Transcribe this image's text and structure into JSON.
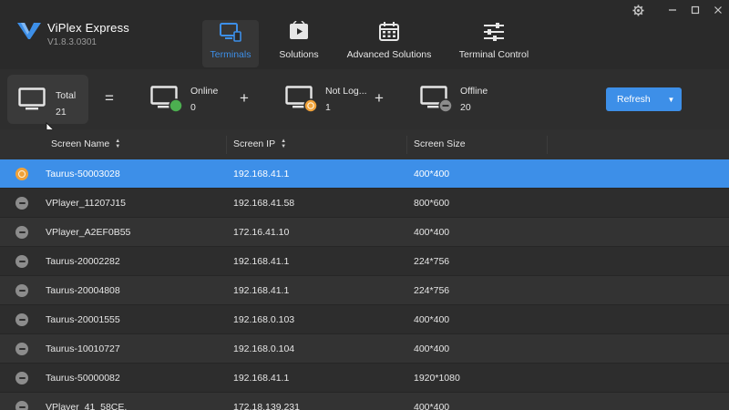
{
  "app": {
    "name": "ViPlex Express",
    "version": "V1.8.3.0301",
    "brand_color": "#3d8fe8"
  },
  "window_controls": [
    {
      "name": "settings",
      "icon": "gear-icon"
    },
    {
      "name": "minimize",
      "icon": "minimize-icon"
    },
    {
      "name": "maximize",
      "icon": "maximize-icon"
    },
    {
      "name": "close",
      "icon": "close-icon"
    }
  ],
  "nav": {
    "tabs": [
      {
        "label": "Terminals",
        "icon": "monitor-icon",
        "active": true
      },
      {
        "label": "Solutions",
        "icon": "play-icon",
        "active": false
      },
      {
        "label": "Advanced Solutions",
        "icon": "calendar-icon",
        "active": false
      },
      {
        "label": "Terminal Control",
        "icon": "sliders-icon",
        "active": false
      }
    ]
  },
  "summary": {
    "total": {
      "label": "Total",
      "value": "21"
    },
    "equals": "=",
    "plus": "+",
    "online": {
      "label": "Online",
      "value": "0",
      "color": "#4caf50"
    },
    "not_logged": {
      "label": "Not Log...",
      "value": "1",
      "color": "#f0a23a"
    },
    "offline": {
      "label": "Offline",
      "value": "20",
      "color": "#8c8c8c"
    }
  },
  "refresh": {
    "label": "Refresh",
    "icon": "caret-down-icon"
  },
  "table": {
    "columns": [
      "Screen Name",
      "Screen IP",
      "Screen Size"
    ],
    "rows": [
      {
        "status": "not-logged",
        "name": "Taurus-50003028",
        "ip": "192.168.41.1",
        "size": "400*400",
        "selected": true
      },
      {
        "status": "offline",
        "name": "VPlayer_11207J15",
        "ip": "192.168.41.58",
        "size": "800*600"
      },
      {
        "status": "offline",
        "name": "VPlayer_A2EF0B55",
        "ip": "172.16.41.10",
        "size": "400*400"
      },
      {
        "status": "offline",
        "name": "Taurus-20002282",
        "ip": "192.168.41.1",
        "size": "224*756"
      },
      {
        "status": "offline",
        "name": "Taurus-20004808",
        "ip": "192.168.41.1",
        "size": "224*756"
      },
      {
        "status": "offline",
        "name": "Taurus-20001555",
        "ip": "192.168.0.103",
        "size": "400*400"
      },
      {
        "status": "offline",
        "name": "Taurus-10010727",
        "ip": "192.168.0.104",
        "size": "400*400"
      },
      {
        "status": "offline",
        "name": "Taurus-50000082",
        "ip": "192.168.41.1",
        "size": "1920*1080"
      },
      {
        "status": "offline",
        "name": "VPlayer_41_58CE.",
        "ip": "172.18.139.231",
        "size": "400*400"
      }
    ]
  }
}
